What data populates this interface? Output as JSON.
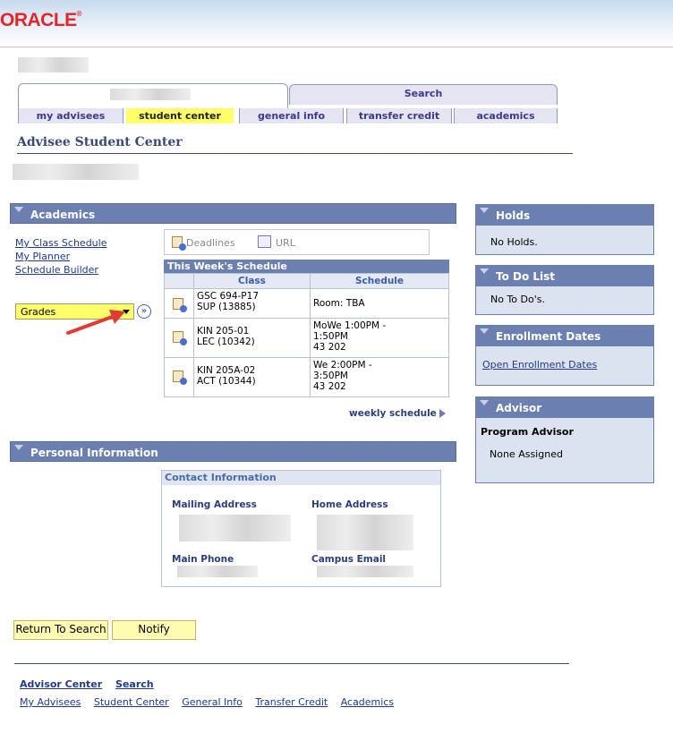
{
  "branding": {
    "logo": "ORACLE",
    "reg": "®"
  },
  "nav": {
    "top_tabs": {
      "search": "Search"
    },
    "sub_tabs": [
      "my advisees",
      "student center",
      "general info",
      "transfer credit",
      "academics"
    ]
  },
  "page": {
    "title": "Advisee Student Center"
  },
  "academics": {
    "header": "Academics",
    "links": [
      "My Class Schedule",
      "My Planner",
      "Schedule Builder"
    ],
    "dropdown_value": "Grades",
    "deadlines_label": "Deadlines",
    "url_label": "URL",
    "schedule": {
      "title": "This Week's Schedule",
      "headers": [
        "Class",
        "Schedule"
      ],
      "rows": [
        {
          "class_line1": "GSC 694-P17",
          "class_line2": "SUP (13885)",
          "sched1": "Room:  TBA",
          "sched2": "",
          "sched3": ""
        },
        {
          "class_line1": "KIN 205-01",
          "class_line2": "LEC (10342)",
          "sched1": "MoWe 1:00PM -",
          "sched2": "1:50PM",
          "sched3": "43 202"
        },
        {
          "class_line1": "KIN 205A-02",
          "class_line2": "ACT (10344)",
          "sched1": "We 2:00PM -",
          "sched2": "3:50PM",
          "sched3": "43 202"
        }
      ],
      "weekly_link": "weekly schedule"
    }
  },
  "personal": {
    "header": "Personal Information",
    "contact_title": "Contact Information",
    "mailing_address": "Mailing Address",
    "home_address": "Home Address",
    "main_phone": "Main Phone",
    "campus_email": "Campus Email"
  },
  "side": {
    "holds": {
      "header": "Holds",
      "text": "No Holds."
    },
    "todo": {
      "header": "To Do List",
      "text": "No To Do's."
    },
    "enrollment": {
      "header": "Enrollment Dates",
      "link": "Open Enrollment Dates"
    },
    "advisor": {
      "header": "Advisor",
      "label": "Program Advisor",
      "value": "None Assigned"
    }
  },
  "buttons": {
    "return": "Return To Search",
    "notify": "Notify"
  },
  "footer": {
    "row1": [
      "Advisor Center",
      "Search"
    ],
    "row2": [
      "My Advisees",
      "Student Center",
      "General Info",
      "Transfer Credit",
      "Academics"
    ]
  },
  "colors": {
    "section_header": "#6b7fb1",
    "active_tab": "#ffff6a",
    "oracle_red": "#e0262a",
    "annotation_arrow": "#e03c31"
  }
}
